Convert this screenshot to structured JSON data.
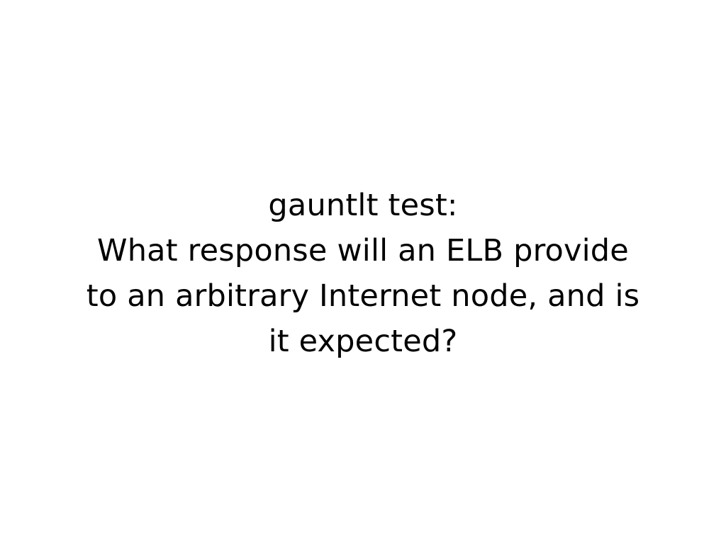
{
  "slide": {
    "lines": [
      "gauntlt test:",
      "What response will an ELB provide",
      "to an arbitrary Internet node, and is",
      "it expected?"
    ],
    "background_color": "#ffffff",
    "text_color": "#000000"
  }
}
